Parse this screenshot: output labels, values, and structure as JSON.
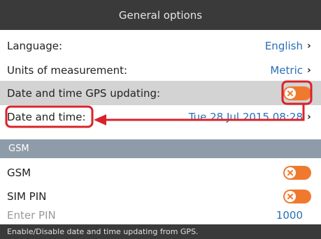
{
  "header": {
    "title": "General options"
  },
  "settings": [
    {
      "label": "Language:",
      "value": "English"
    },
    {
      "label": "Units of measurement:",
      "value": "Metric"
    },
    {
      "label": "Date and time GPS updating:",
      "toggle": "off"
    },
    {
      "label": "Date and time:",
      "value": "Tue 28 Jul 2015 08:28"
    }
  ],
  "gsm_section": {
    "title": "GSM",
    "items": [
      {
        "label": "GSM",
        "toggle": "off"
      },
      {
        "label": "SIM PIN",
        "toggle": "off"
      },
      {
        "label": "Enter PIN",
        "value": "1000"
      }
    ]
  },
  "footer": {
    "hint": "Enable/Disable date and time updating from GPS."
  },
  "colors": {
    "accent_blue": "#2a6fb4",
    "toggle_orange": "#ef7a2f",
    "annotation_red": "#d8232a",
    "header_bg": "#3a3a3a",
    "section_bg": "#8e9ca9"
  }
}
